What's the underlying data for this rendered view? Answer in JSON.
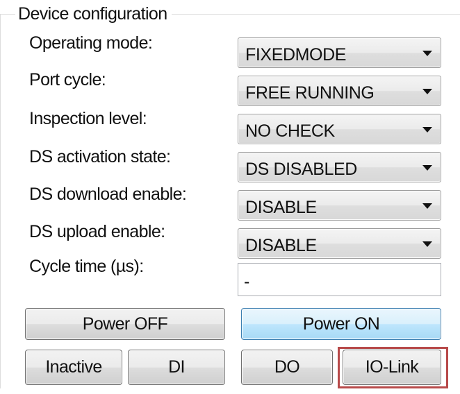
{
  "group": {
    "title": "Device configuration"
  },
  "settings": [
    {
      "label": "Operating mode:",
      "value": "FIXEDMODE"
    },
    {
      "label": "Port cycle:",
      "value": "FREE RUNNING"
    },
    {
      "label": "Inspection level:",
      "value": "NO CHECK"
    },
    {
      "label": "DS activation state:",
      "value": "DS DISABLED"
    },
    {
      "label": "DS download enable:",
      "value": "DISABLE"
    },
    {
      "label": "DS upload enable:",
      "value": "DISABLE"
    }
  ],
  "cycle_time": {
    "label": "Cycle time (µs):",
    "value": "-"
  },
  "buttons": {
    "power_off": "Power OFF",
    "power_on": "Power ON",
    "inactive": "Inactive",
    "di": "DI",
    "do": "DO",
    "io_link": "IO-Link"
  },
  "colors": {
    "highlight": "#b84a4a",
    "power_on_accent": "#3c7fb1"
  }
}
